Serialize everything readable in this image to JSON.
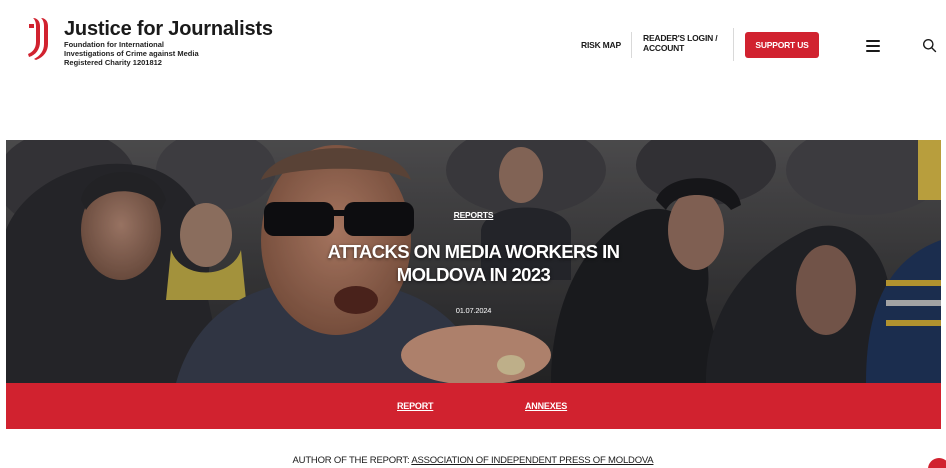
{
  "brand": {
    "name": "Justice for Journalists",
    "subtitle_lines": [
      "Foundation for International",
      "Investigations of Crime against Media",
      "Registered Charity 1201812"
    ],
    "accent_color": "#d1222f"
  },
  "nav": {
    "risk_map": "RISK MAP",
    "login_line1": "READER'S LOGIN /",
    "login_line2": "ACCOUNT",
    "support": "SUPPORT US",
    "menu_icon": "hamburger-menu-icon",
    "search_icon": "search-icon"
  },
  "hero": {
    "category": "REPORTS",
    "title_line1": "ATTACKS ON MEDIA WORKERS IN",
    "title_line2": "MOLDOVA IN 2023",
    "date": "01.07.2024"
  },
  "tabs": [
    {
      "label": "REPORT"
    },
    {
      "label": "ANNEXES"
    }
  ],
  "author": {
    "prefix": "AUTHOR OF THE REPORT: ",
    "link": "ASSOCIATION OF INDEPENDENT PRESS OF MOLDOVA"
  }
}
